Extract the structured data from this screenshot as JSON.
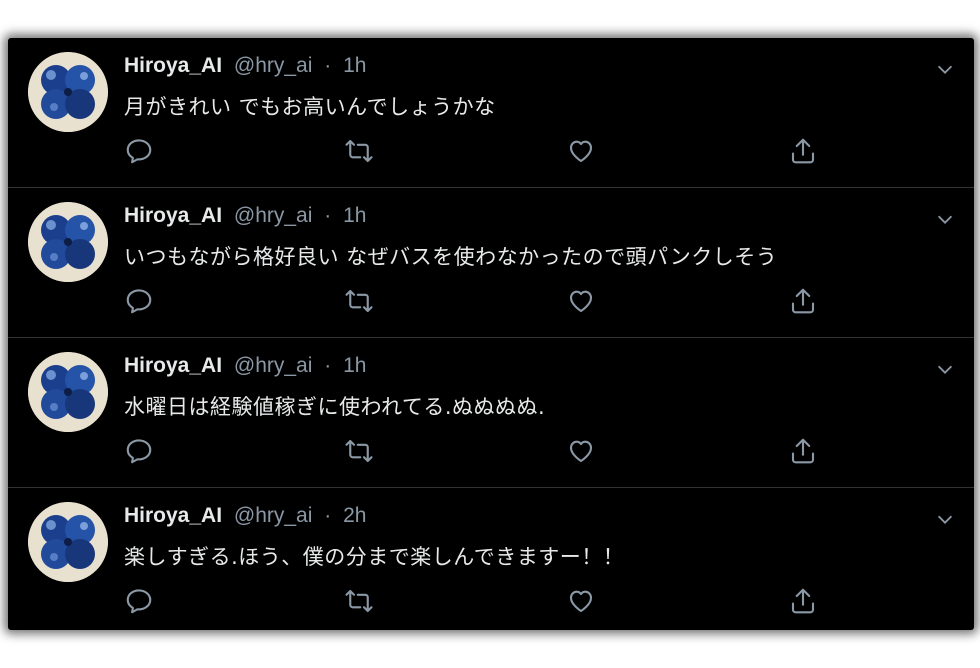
{
  "tweets": [
    {
      "display_name": "Hiroya_AI",
      "handle": "@hry_ai",
      "separator": "·",
      "time": "1h",
      "text": "月がきれい でもお高いんでしょうかな"
    },
    {
      "display_name": "Hiroya_AI",
      "handle": "@hry_ai",
      "separator": "·",
      "time": "1h",
      "text": "いつもながら格好良い なぜバスを使わなかったので頭パンクしそう"
    },
    {
      "display_name": "Hiroya_AI",
      "handle": "@hry_ai",
      "separator": "·",
      "time": "1h",
      "text": "水曜日は経験値稼ぎに使われてる.ぬぬぬぬ."
    },
    {
      "display_name": "Hiroya_AI",
      "handle": "@hry_ai",
      "separator": "·",
      "time": "2h",
      "text": "楽しすぎる.ほう、僕の分まで楽しんできますー！！"
    }
  ],
  "icons": {
    "avatar": "blue-clover-avatar",
    "reply": "reply-icon",
    "retweet": "retweet-icon",
    "like": "heart-icon",
    "share": "share-icon",
    "more": "chevron-down-icon"
  },
  "colors": {
    "background": "#000000",
    "text": "#e7e9ea",
    "muted": "#8b98a5",
    "divider": "#2f3336"
  }
}
